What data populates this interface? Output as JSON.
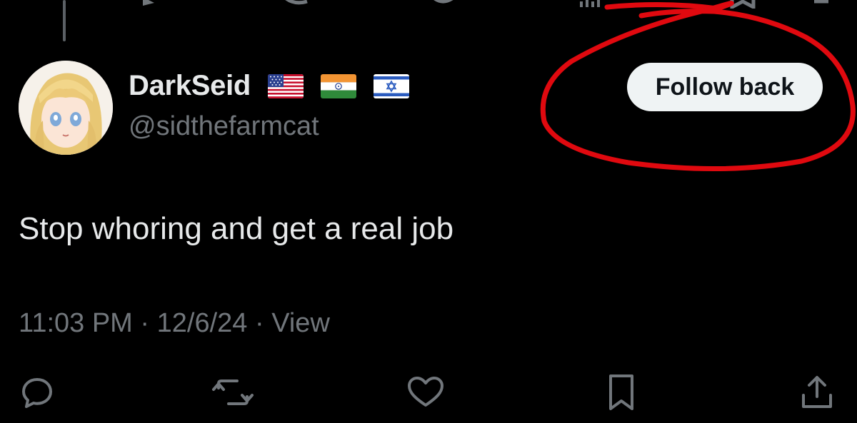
{
  "user": {
    "display_name": "DarkSeid",
    "handle": "@sidthefarmcat",
    "flags": [
      "us-flag",
      "india-flag",
      "israel-flag"
    ]
  },
  "follow_button": {
    "label": "Follow back"
  },
  "tweet": {
    "text": "Stop whoring and get a real job",
    "time": "11:03 PM",
    "date": "12/6/24",
    "view_label": "View"
  },
  "actions": [
    "reply-icon",
    "retweet-icon",
    "like-icon",
    "bookmark-icon",
    "share-icon"
  ],
  "colors": {
    "background": "#000000",
    "text_primary": "#e7e9ea",
    "text_secondary": "#71767b",
    "button_bg": "#eff3f4",
    "annotation_red": "#e0090f"
  }
}
